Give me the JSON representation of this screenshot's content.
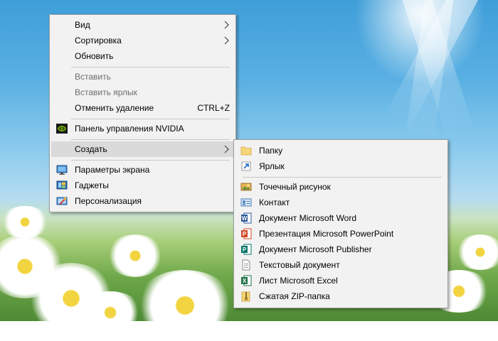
{
  "main_menu": {
    "items": [
      {
        "label": "Вид",
        "submenu": true,
        "disabled": false
      },
      {
        "label": "Сортировка",
        "submenu": true,
        "disabled": false
      },
      {
        "label": "Обновить",
        "submenu": false,
        "disabled": false
      },
      {
        "label": "Вставить",
        "submenu": false,
        "disabled": true
      },
      {
        "label": "Вставить ярлык",
        "submenu": false,
        "disabled": true
      },
      {
        "label": "Отменить удаление",
        "shortcut": "CTRL+Z",
        "submenu": false,
        "disabled": false
      },
      {
        "label": "Панель управления NVIDIA",
        "icon": "nvidia-icon",
        "submenu": false,
        "disabled": false
      },
      {
        "label": "Создать",
        "submenu": true,
        "highlighted": true,
        "disabled": false
      },
      {
        "label": "Параметры экрана",
        "icon": "display-settings-icon",
        "submenu": false,
        "disabled": false
      },
      {
        "label": "Гаджеты",
        "icon": "gadgets-icon",
        "submenu": false,
        "disabled": false
      },
      {
        "label": "Персонализация",
        "icon": "personalization-icon",
        "submenu": false,
        "disabled": false
      }
    ]
  },
  "create_submenu": {
    "items": [
      {
        "label": "Папку",
        "icon": "folder-icon"
      },
      {
        "label": "Ярлык",
        "icon": "shortcut-icon"
      },
      {
        "label": "Точечный рисунок",
        "icon": "bitmap-icon"
      },
      {
        "label": "Контакт",
        "icon": "contact-icon"
      },
      {
        "label": "Документ Microsoft Word",
        "icon": "word-icon"
      },
      {
        "label": "Презентация Microsoft PowerPoint",
        "icon": "powerpoint-icon"
      },
      {
        "label": "Документ Microsoft Publisher",
        "icon": "publisher-icon"
      },
      {
        "label": "Текстовый документ",
        "icon": "text-document-icon"
      },
      {
        "label": "Лист Microsoft Excel",
        "icon": "excel-icon"
      },
      {
        "label": "Сжатая ZIP-папка",
        "icon": "zip-folder-icon"
      }
    ]
  },
  "colors": {
    "menu_bg": "#f2f2f2",
    "highlight": "#dadada",
    "disabled_text": "#6d6d6d",
    "word": "#2b579a",
    "powerpoint": "#d24726",
    "publisher": "#077568",
    "excel": "#217346",
    "nvidia": "#76b900"
  }
}
